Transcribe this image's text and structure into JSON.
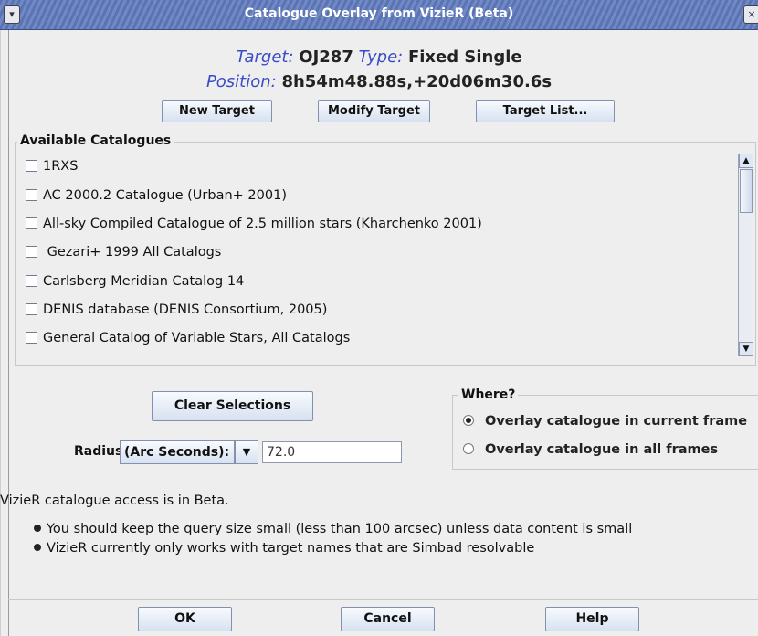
{
  "window": {
    "title": "Catalogue Overlay from VizieR (Beta)",
    "menu_icon": "chevron-down-icon",
    "close_icon": "close-icon"
  },
  "target": {
    "target_label": "Target:",
    "target_value": "OJ287",
    "type_label": "Type:",
    "type_value": "Fixed Single",
    "position_label": "Position:",
    "position_value": "8h54m48.88s,+20d06m30.6s"
  },
  "target_buttons": {
    "new": "New Target",
    "modify": "Modify Target",
    "list": "Target List..."
  },
  "catalogues": {
    "title": "Available Catalogues",
    "items": [
      {
        "label": "1RXS",
        "checked": false
      },
      {
        "label": "AC 2000.2 Catalogue (Urban+ 2001)",
        "checked": false
      },
      {
        "label": "All-sky Compiled Catalogue of 2.5 million stars (Kharchenko 2001)",
        "checked": false
      },
      {
        "label": " Gezari+ 1999 All Catalogs",
        "checked": false
      },
      {
        "label": "Carlsberg Meridian Catalog 14",
        "checked": false
      },
      {
        "label": "DENIS database (DENIS Consortium, 2005)",
        "checked": false
      },
      {
        "label": "General Catalog of Variable Stars, All Catalogs",
        "checked": false
      }
    ]
  },
  "clear_button": "Clear Selections",
  "radius": {
    "label": "Radius",
    "units": "(Arc Seconds):",
    "value": "72.0"
  },
  "where": {
    "title": "Where?",
    "options": [
      {
        "label": "Overlay catalogue in current frame",
        "selected": true
      },
      {
        "label": "Overlay catalogue in all frames",
        "selected": false
      }
    ]
  },
  "notes": {
    "header": "VizieR catalogue access is in Beta.",
    "bullets": [
      "You should keep the query size small (less than 100 arcsec) unless data content is small",
      "VizieR currently only works with target names that are Simbad resolvable"
    ]
  },
  "footer": {
    "ok": "OK",
    "cancel": "Cancel",
    "help": "Help"
  },
  "colors": {
    "label_blue": "#3a4cc7",
    "title_bar": "#6b82bf",
    "background": "#eeeeee"
  }
}
